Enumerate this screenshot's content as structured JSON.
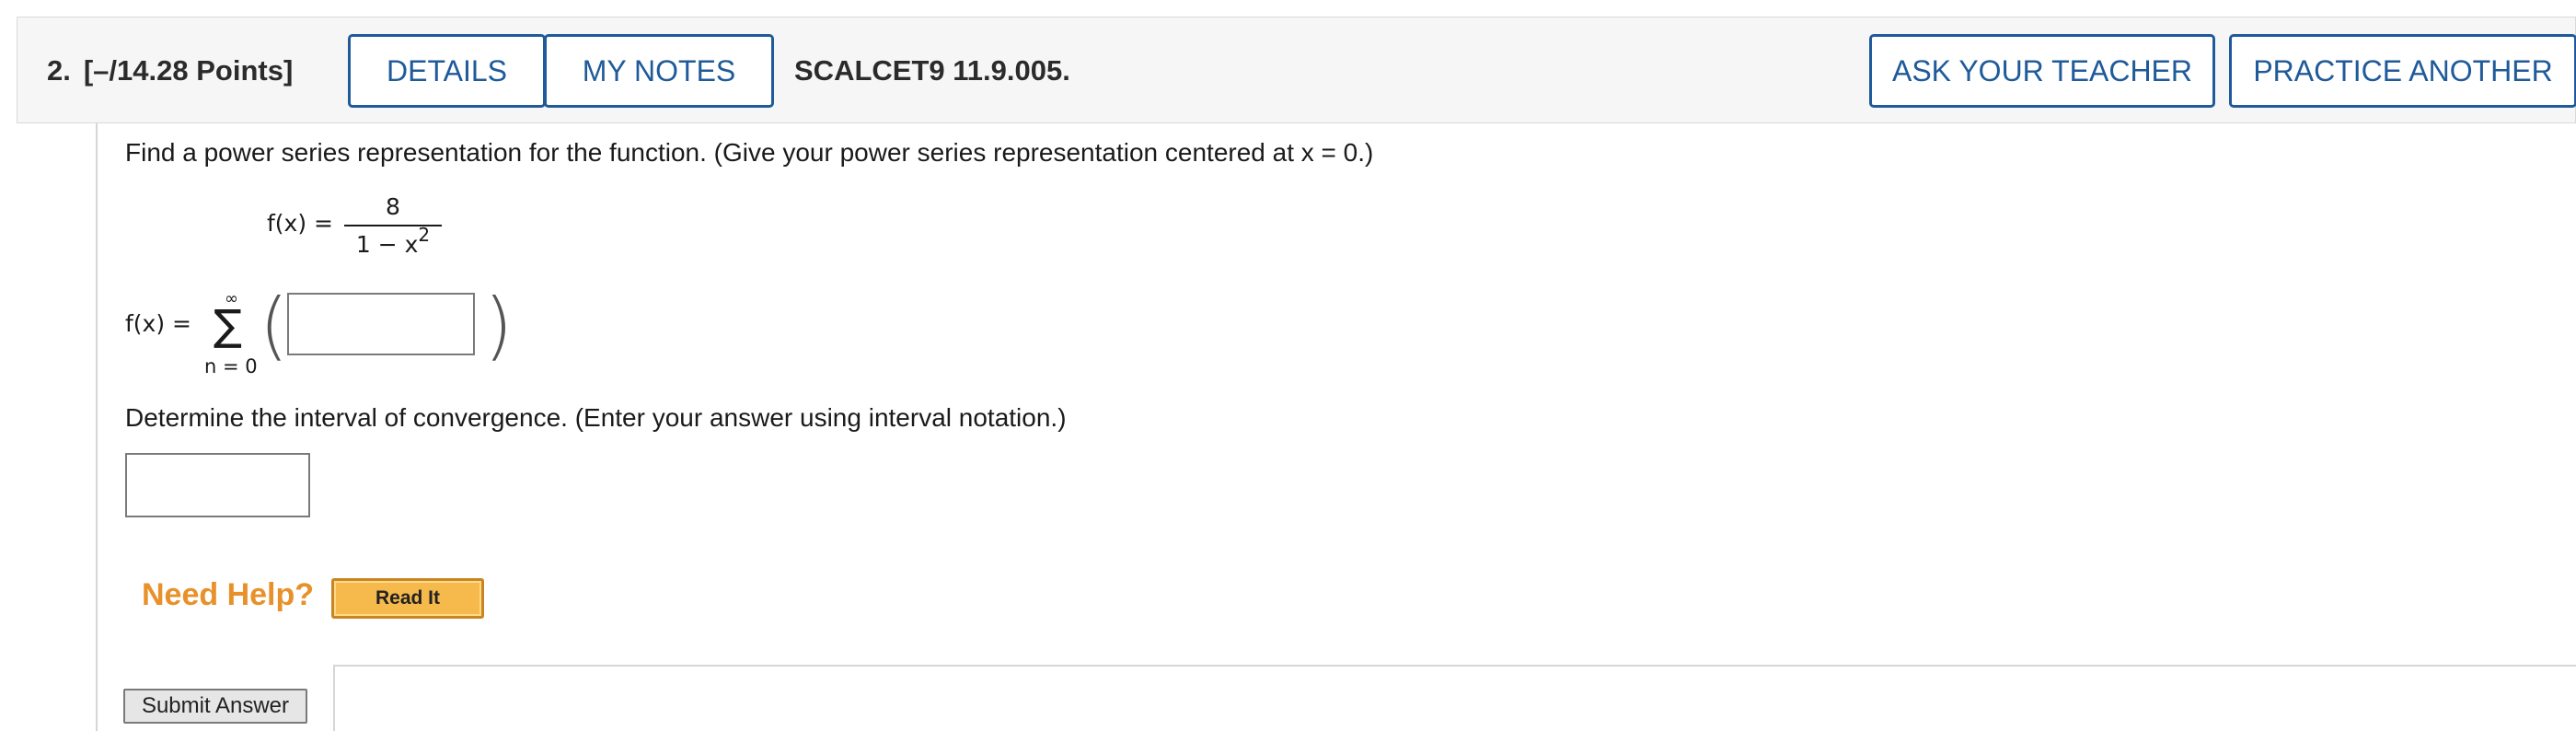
{
  "question": {
    "number": "2.",
    "points": "[–/14.28 Points]",
    "code": "SCALCET9 11.9.005."
  },
  "header_buttons": {
    "details": "DETAILS",
    "my_notes": "MY NOTES",
    "ask_teacher": "ASK YOUR TEACHER",
    "practice_another": "PRACTICE ANOTHER"
  },
  "instructions": {
    "power_series": "Find a power series representation for the function. (Give your power series representation centered at x = 0.)",
    "interval": "Determine the interval of convergence. (Enter your answer using interval notation.)"
  },
  "function": {
    "lhs": "f(x) =",
    "numerator": "8",
    "denominator_base": "1 − x",
    "denominator_exp": "2"
  },
  "series": {
    "lhs": "f(x) =",
    "upper_limit": "∞",
    "sigma": "∑",
    "lower_limit": "n = 0",
    "left_paren": "(",
    "right_paren": ")",
    "term_value": ""
  },
  "interval_answer": {
    "value": ""
  },
  "help": {
    "label": "Need Help?",
    "read_it": "Read It"
  },
  "submit": {
    "label": "Submit Answer"
  },
  "colors": {
    "button_border": "#1f5a9a",
    "need_help": "#e8912a",
    "read_it_bg": "#f5b94c"
  }
}
